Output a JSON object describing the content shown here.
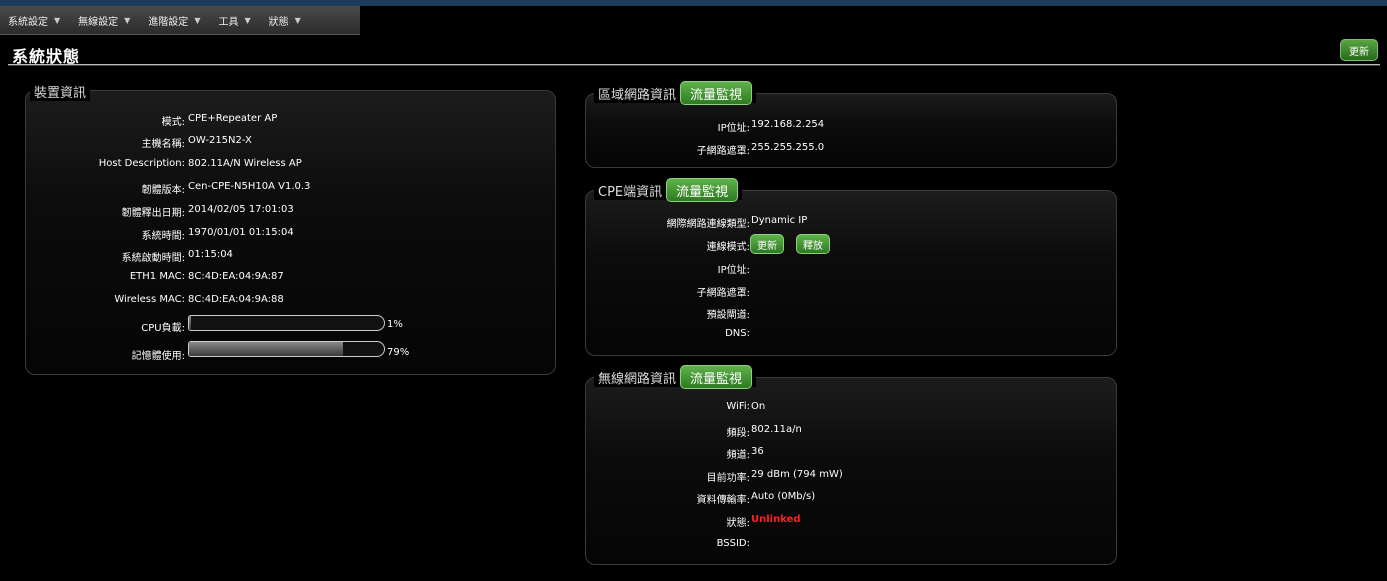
{
  "menu": [
    {
      "label": "系統設定"
    },
    {
      "label": "無線設定"
    },
    {
      "label": "進階設定"
    },
    {
      "label": "工具"
    },
    {
      "label": "狀態"
    }
  ],
  "page": {
    "title": "系統狀態",
    "refresh_label": "更新"
  },
  "device": {
    "legend": "裝置資訊",
    "rows": [
      {
        "label": "模式:",
        "value": "CPE+Repeater AP"
      },
      {
        "label": "主機名稱:",
        "value": "OW-215N2-X"
      },
      {
        "label": "Host Description:",
        "value": "802.11A/N Wireless AP"
      },
      {
        "label": "韌體版本:",
        "value": "Cen-CPE-N5H10A V1.0.3"
      },
      {
        "label": "韌體釋出日期:",
        "value": "2014/02/05 17:01:03"
      },
      {
        "label": "系統時間:",
        "value": "1970/01/01 01:15:04"
      },
      {
        "label": "系統啟動時間:",
        "value": "01:15:04"
      },
      {
        "label": "ETH1 MAC:",
        "value": "8C:4D:EA:04:9A:87"
      },
      {
        "label": "Wireless MAC:",
        "value": "8C:4D:EA:04:9A:88"
      }
    ],
    "cpu": {
      "label": "CPU負載:",
      "value": "1%",
      "fraction": 0.01
    },
    "mem": {
      "label": "記憶體使用:",
      "value": "79%",
      "fraction": 0.79
    }
  },
  "lan": {
    "legend": "區域網路資訊",
    "monitor_label": "流量監視",
    "rows": [
      {
        "label": "IP位址:",
        "value": "192.168.2.254"
      },
      {
        "label": "子網路遮罩:",
        "value": "255.255.255.0"
      }
    ]
  },
  "cpe": {
    "legend": "CPE端資訊",
    "monitor_label": "流量監視",
    "conn_type_label": "網際網路連線類型:",
    "conn_type_value": "Dynamic IP",
    "conn_mode_label": "連線模式:",
    "renew_label": "更新",
    "release_label": "釋放",
    "ip_label": "IP位址:",
    "mask_label": "子網路遮罩:",
    "gw_label": "預設閘道:",
    "dns_label": "DNS:"
  },
  "wireless": {
    "legend": "無線網路資訊",
    "monitor_label": "流量監視",
    "rows": [
      {
        "label": "WiFi:",
        "value": "On"
      },
      {
        "label": "頻段:",
        "value": "802.11a/n"
      },
      {
        "label": "頻道:",
        "value": "36"
      },
      {
        "label": "目前功率:",
        "value": "29 dBm (794 mW)"
      },
      {
        "label": "資料傳輸率:",
        "value": "Auto (0Mb/s)"
      }
    ],
    "status_label": "狀態:",
    "status_value": "Unlinked",
    "status_color": "#ff2020",
    "bssid_label": "BSSID:"
  }
}
